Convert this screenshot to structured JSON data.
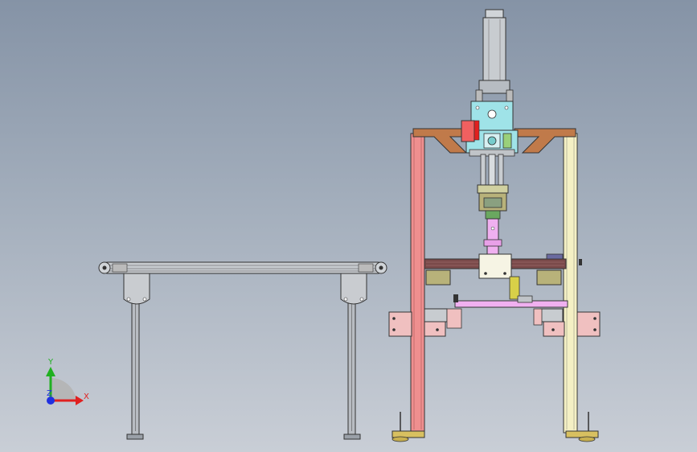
{
  "viewport": {
    "background_top": "#8593a6",
    "background_bottom": "#c9ced6"
  },
  "triad": {
    "x_label": "X",
    "y_label": "Y",
    "z_label": "Z",
    "x_color": "#e02020",
    "y_color": "#20b020",
    "z_color": "#2030e0"
  },
  "colors": {
    "frame_red": "#ef8f8f",
    "frame_yellow": "#f4f0c4",
    "bracket_brown": "#c07a4a",
    "cylinder_gray": "#c8ccd0",
    "mount_cyan": "#9fe3e8",
    "arm_pink": "#f0b0f0",
    "olive": "#b8b27a",
    "conveyor_steel": "#9aa0a8",
    "plate_pink": "#f0c0c0"
  }
}
